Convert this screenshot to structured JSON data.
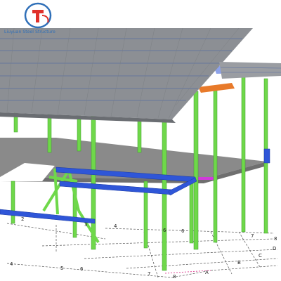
{
  "logo": {
    "company_name": "Liuyuan Steel Structure",
    "icon": "logo-mark-icon",
    "colors": {
      "ring": "#2f6fb8",
      "mark": "#e0302a"
    }
  },
  "grid_labels": [
    "2",
    "3",
    "4",
    "6",
    "6",
    "7",
    "8",
    "D",
    "C",
    "B",
    "4",
    "5",
    "6",
    "7",
    "8",
    "A"
  ],
  "colors": {
    "roof": "#8c8f94",
    "roof_seam": "#5a6fa0",
    "slab": "#8a8a8a",
    "column": "#6fd84a",
    "beam": "#2f56d8",
    "rafter_accent": "#e87a2a",
    "edge_magenta": "#d23adb",
    "grid_line": "#555555"
  }
}
